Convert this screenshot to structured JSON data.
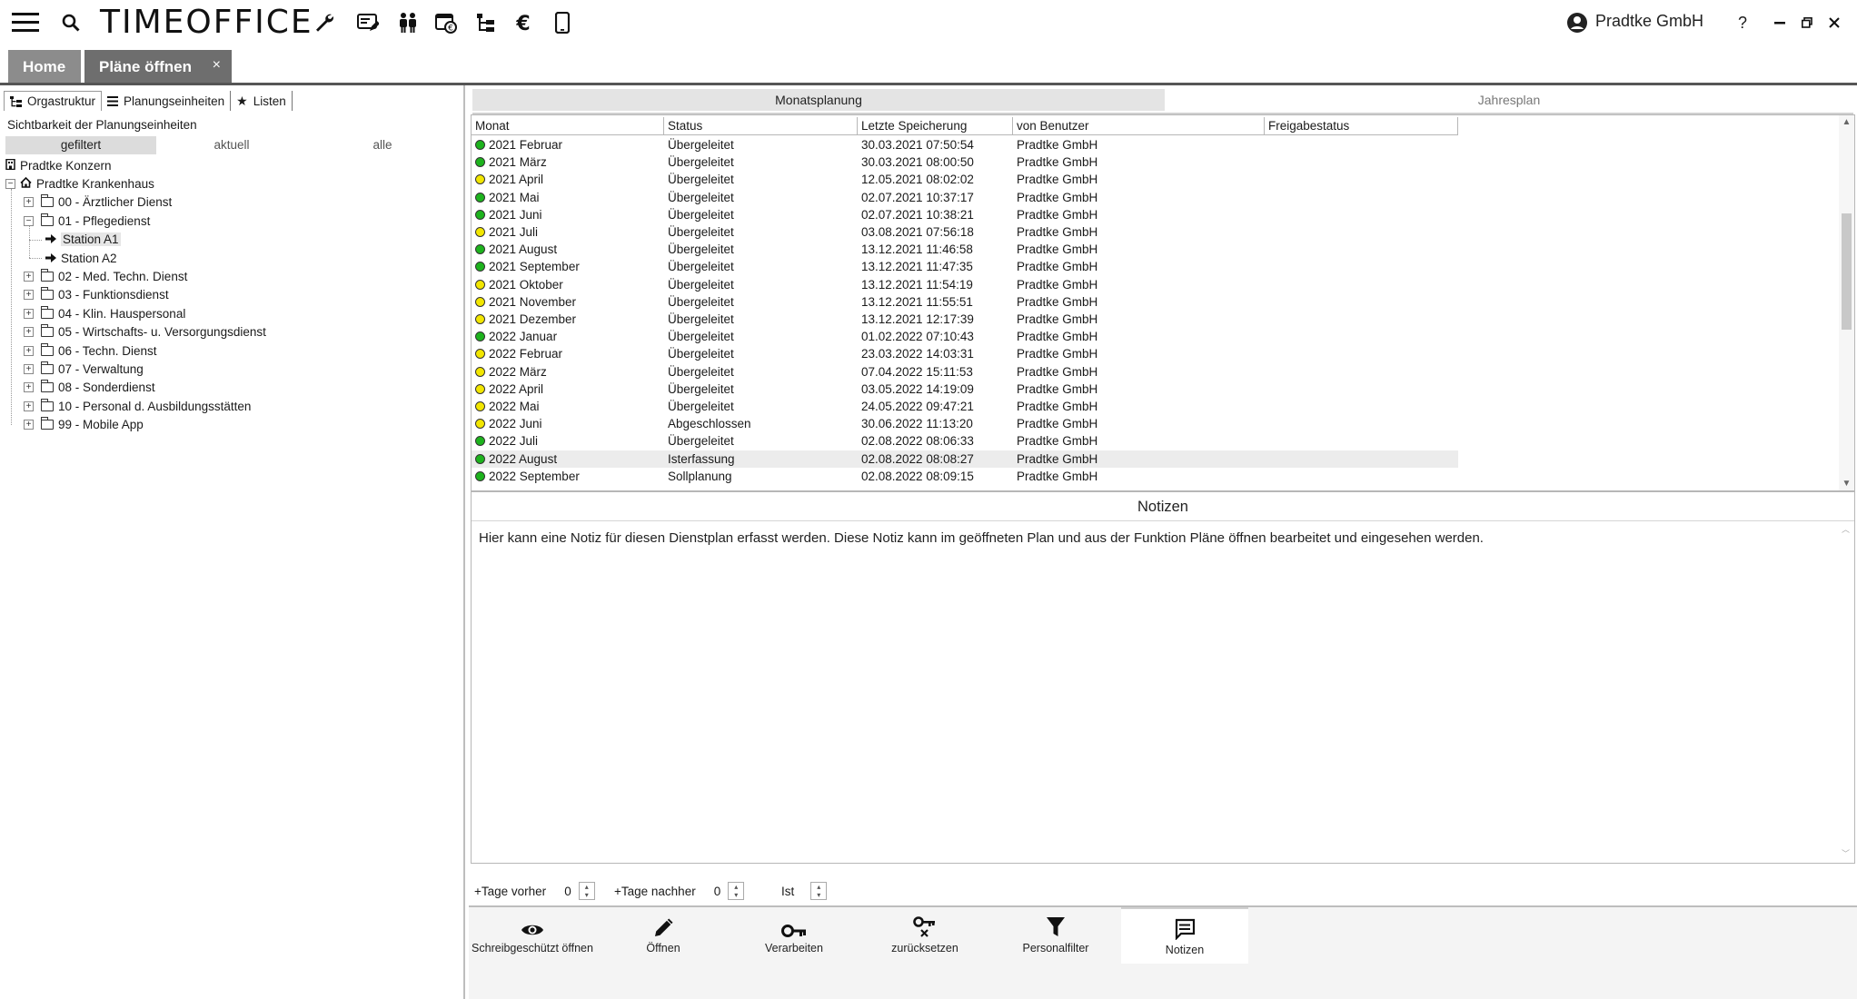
{
  "app": {
    "title": "TIMEOFFICE",
    "user": "Pradtke GmbH",
    "help": "?"
  },
  "toolbar_icons": [
    "menu-icon",
    "search-icon",
    "wrench-icon",
    "card-edit-icon",
    "people-icon",
    "calendar-euro-icon",
    "org-tree-icon",
    "euro-icon",
    "mobile-icon"
  ],
  "tabs": {
    "home": "Home",
    "plaene": "Pläne öffnen",
    "close": "×"
  },
  "left": {
    "tabs": [
      "Orgastruktur",
      "Planungseinheiten",
      "Listen"
    ],
    "visibility_label": "Sichtbarkeit der Planungseinheiten",
    "segments": [
      "gefiltert",
      "aktuell",
      "alle"
    ],
    "tree": [
      {
        "label": "Pradtke Konzern",
        "level": 0,
        "kind": "root"
      },
      {
        "label": "Pradtke Krankenhaus",
        "level": 0,
        "kind": "house",
        "expanded": true
      },
      {
        "label": "00 - Ärztlicher Dienst",
        "level": 1,
        "kind": "folder",
        "expanded": false
      },
      {
        "label": "01 - Pflegedienst",
        "level": 1,
        "kind": "folder",
        "expanded": true
      },
      {
        "label": "Station A1",
        "level": 2,
        "kind": "unit",
        "selected": true
      },
      {
        "label": "Station A2",
        "level": 2,
        "kind": "unit"
      },
      {
        "label": "02 - Med. Techn. Dienst",
        "level": 1,
        "kind": "folder"
      },
      {
        "label": "03 - Funktionsdienst",
        "level": 1,
        "kind": "folder"
      },
      {
        "label": "04 - Klin. Hauspersonal",
        "level": 1,
        "kind": "folder"
      },
      {
        "label": "05 - Wirtschafts- u. Versorgungsdienst",
        "level": 1,
        "kind": "folder"
      },
      {
        "label": "06 - Techn. Dienst",
        "level": 1,
        "kind": "folder"
      },
      {
        "label": "07 - Verwaltung",
        "level": 1,
        "kind": "folder"
      },
      {
        "label": "08 - Sonderdienst",
        "level": 1,
        "kind": "folder"
      },
      {
        "label": "10 - Personal d. Ausbildungsstätten",
        "level": 1,
        "kind": "folder"
      },
      {
        "label": "99 - Mobile App",
        "level": 1,
        "kind": "folder"
      }
    ]
  },
  "plan": {
    "tabs": [
      "Monatsplanung",
      "Jahresplan"
    ],
    "columns": [
      "Monat",
      "Status",
      "Letzte Speicherung",
      "von Benutzer",
      "Freigabestatus"
    ],
    "colors": {
      "green": "#1db31d",
      "yellow": "#f2e600"
    },
    "rows": [
      {
        "dot": "green",
        "monat": "2021 Februar",
        "status": "Übergeleitet",
        "saved": "30.03.2021 07:50:54",
        "user": "Pradtke GmbH",
        "freigabe": ""
      },
      {
        "dot": "green",
        "monat": "2021 März",
        "status": "Übergeleitet",
        "saved": "30.03.2021 08:00:50",
        "user": "Pradtke GmbH",
        "freigabe": ""
      },
      {
        "dot": "yellow",
        "monat": "2021 April",
        "status": "Übergeleitet",
        "saved": "12.05.2021 08:02:02",
        "user": "Pradtke GmbH",
        "freigabe": ""
      },
      {
        "dot": "green",
        "monat": "2021 Mai",
        "status": "Übergeleitet",
        "saved": "02.07.2021 10:37:17",
        "user": "Pradtke GmbH",
        "freigabe": ""
      },
      {
        "dot": "green",
        "monat": "2021 Juni",
        "status": "Übergeleitet",
        "saved": "02.07.2021 10:38:21",
        "user": "Pradtke GmbH",
        "freigabe": ""
      },
      {
        "dot": "yellow",
        "monat": "2021 Juli",
        "status": "Übergeleitet",
        "saved": "03.08.2021 07:56:18",
        "user": "Pradtke GmbH",
        "freigabe": ""
      },
      {
        "dot": "green",
        "monat": "2021 August",
        "status": "Übergeleitet",
        "saved": "13.12.2021 11:46:58",
        "user": "Pradtke GmbH",
        "freigabe": ""
      },
      {
        "dot": "green",
        "monat": "2021 September",
        "status": "Übergeleitet",
        "saved": "13.12.2021 11:47:35",
        "user": "Pradtke GmbH",
        "freigabe": ""
      },
      {
        "dot": "yellow",
        "monat": "2021 Oktober",
        "status": "Übergeleitet",
        "saved": "13.12.2021 11:54:19",
        "user": "Pradtke GmbH",
        "freigabe": ""
      },
      {
        "dot": "yellow",
        "monat": "2021 November",
        "status": "Übergeleitet",
        "saved": "13.12.2021 11:55:51",
        "user": "Pradtke GmbH",
        "freigabe": ""
      },
      {
        "dot": "yellow",
        "monat": "2021 Dezember",
        "status": "Übergeleitet",
        "saved": "13.12.2021 12:17:39",
        "user": "Pradtke GmbH",
        "freigabe": ""
      },
      {
        "dot": "green",
        "monat": "2022 Januar",
        "status": "Übergeleitet",
        "saved": "01.02.2022 07:10:43",
        "user": "Pradtke GmbH",
        "freigabe": ""
      },
      {
        "dot": "yellow",
        "monat": "2022 Februar",
        "status": "Übergeleitet",
        "saved": "23.03.2022 14:03:31",
        "user": "Pradtke GmbH",
        "freigabe": ""
      },
      {
        "dot": "yellow",
        "monat": "2022 März",
        "status": "Übergeleitet",
        "saved": "07.04.2022 15:11:53",
        "user": "Pradtke GmbH",
        "freigabe": ""
      },
      {
        "dot": "yellow",
        "monat": "2022 April",
        "status": "Übergeleitet",
        "saved": "03.05.2022 14:19:09",
        "user": "Pradtke GmbH",
        "freigabe": ""
      },
      {
        "dot": "yellow",
        "monat": "2022 Mai",
        "status": "Übergeleitet",
        "saved": "24.05.2022 09:47:21",
        "user": "Pradtke GmbH",
        "freigabe": ""
      },
      {
        "dot": "yellow",
        "monat": "2022 Juni",
        "status": "Abgeschlossen",
        "saved": "30.06.2022 11:13:20",
        "user": "Pradtke GmbH",
        "freigabe": ""
      },
      {
        "dot": "green",
        "monat": "2022 Juli",
        "status": "Übergeleitet",
        "saved": "02.08.2022 08:06:33",
        "user": "Pradtke GmbH",
        "freigabe": ""
      },
      {
        "dot": "green",
        "monat": "2022 August",
        "status": "Isterfassung",
        "saved": "02.08.2022 08:08:27",
        "user": "Pradtke GmbH",
        "freigabe": "",
        "highlight": true
      },
      {
        "dot": "green",
        "monat": "2022 September",
        "status": "Sollplanung",
        "saved": "02.08.2022 08:09:15",
        "user": "Pradtke GmbH",
        "freigabe": ""
      }
    ]
  },
  "notes": {
    "title": "Notizen",
    "text": "Hier kann eine Notiz für diesen Dienstplan erfasst werden. Diese Notiz kann im geöffneten Plan und aus der Funktion Pläne öffnen bearbeitet und eingesehen werden."
  },
  "days": {
    "before_label": "+Tage vorher",
    "before_value": "0",
    "after_label": "+Tage nachher",
    "after_value": "0",
    "ist_label": "Ist"
  },
  "actions": [
    {
      "label": "Schreibgeschützt öffnen",
      "icon": "eye-icon"
    },
    {
      "label": "Öffnen",
      "icon": "pencil-icon"
    },
    {
      "label": "Verarbeiten",
      "icon": "key-icon"
    },
    {
      "label": "zurücksetzen",
      "icon": "key-reset-icon"
    },
    {
      "label": "Personalfilter",
      "icon": "filter-icon"
    },
    {
      "label": "Notizen",
      "icon": "notes-icon",
      "active": true
    }
  ]
}
